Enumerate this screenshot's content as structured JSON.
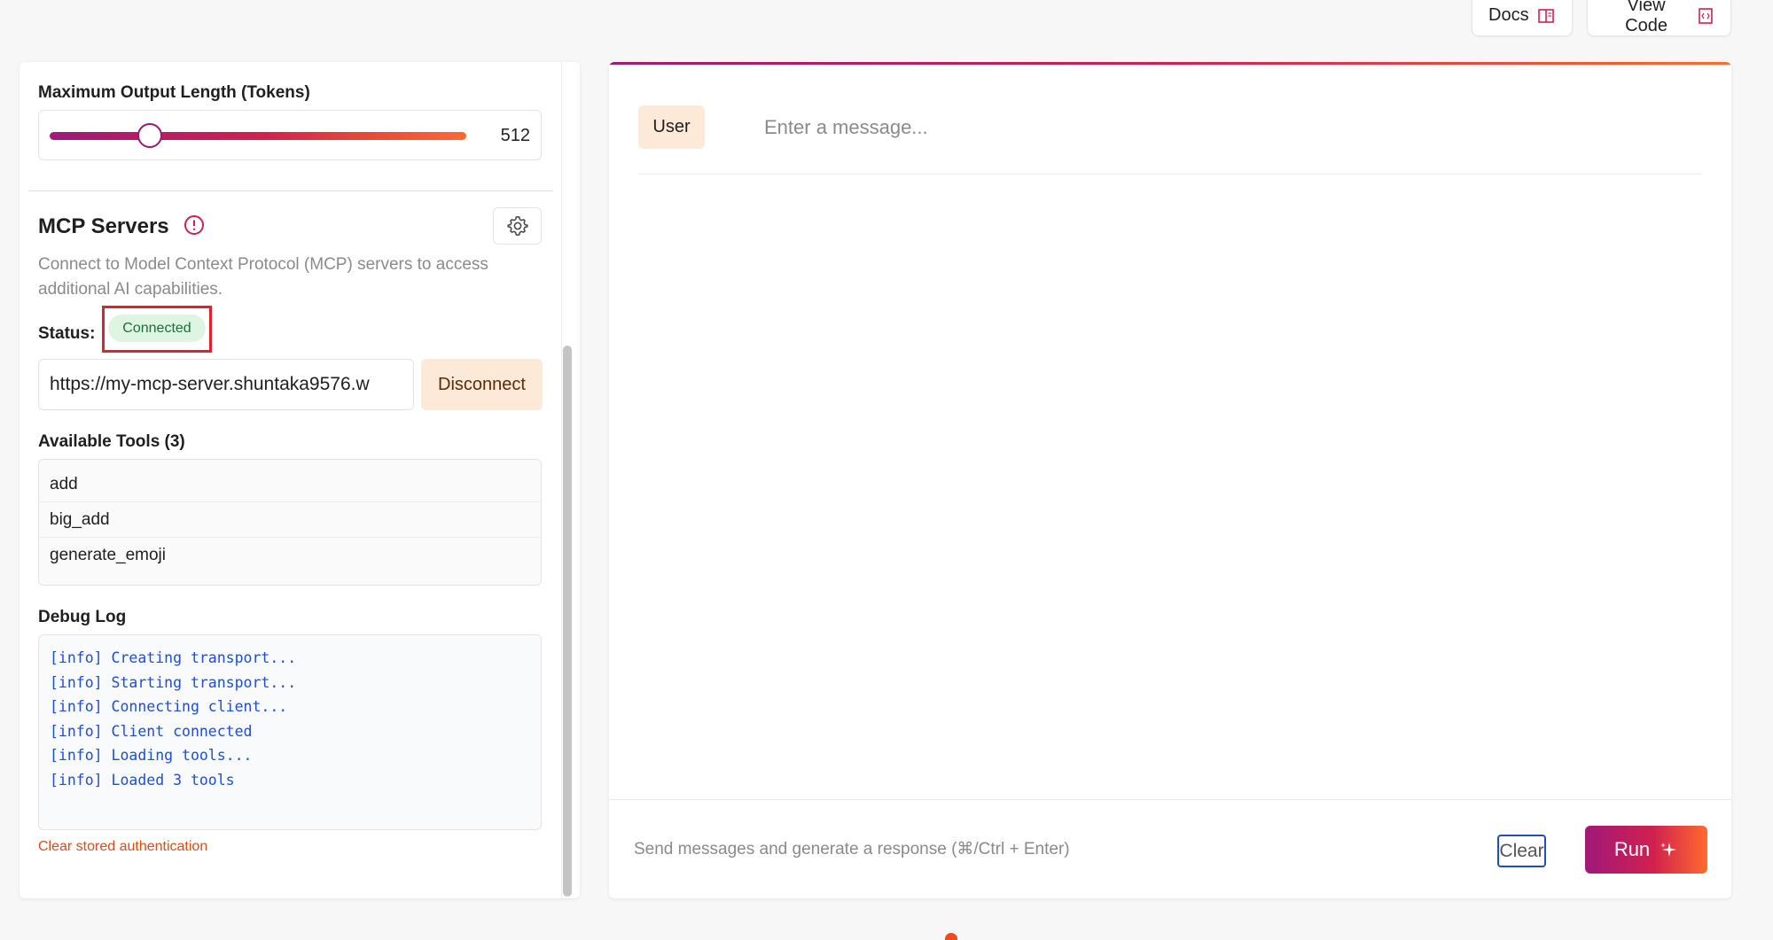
{
  "header": {
    "docs_label": "Docs",
    "view_code_label": "View Code"
  },
  "settings": {
    "max_output_label": "Maximum Output Length (Tokens)",
    "max_output_value": "512",
    "slider_fraction": 0.24
  },
  "mcp": {
    "title": "MCP Servers",
    "description": "Connect to Model Context Protocol (MCP) servers to access additional AI capabilities.",
    "status_label": "Status:",
    "status_value": "Connected",
    "server_url": "https://my-mcp-server.shuntaka9576.w",
    "disconnect_label": "Disconnect",
    "tools_heading": "Available Tools (3)",
    "tools": [
      "add",
      "big_add",
      "generate_emoji"
    ],
    "debug_heading": "Debug Log",
    "debug_log": [
      "[info] Creating transport...",
      "[info] Starting transport...",
      "[info] Connecting client...",
      "[info] Client connected",
      "[info] Loading tools...",
      "[info] Loaded 3 tools"
    ],
    "clear_auth_label": "Clear stored authentication"
  },
  "chat": {
    "role_label": "User",
    "message_placeholder": "Enter a message...",
    "hint": "Send messages and generate a response (⌘/Ctrl + Enter)",
    "clear_label": "Clear",
    "run_label": "Run"
  },
  "colors": {
    "accent_start": "#a0197a",
    "accent_end": "#ff6a2d",
    "status_green_bg": "#dff5e4",
    "highlight_red": "#e4202e"
  }
}
